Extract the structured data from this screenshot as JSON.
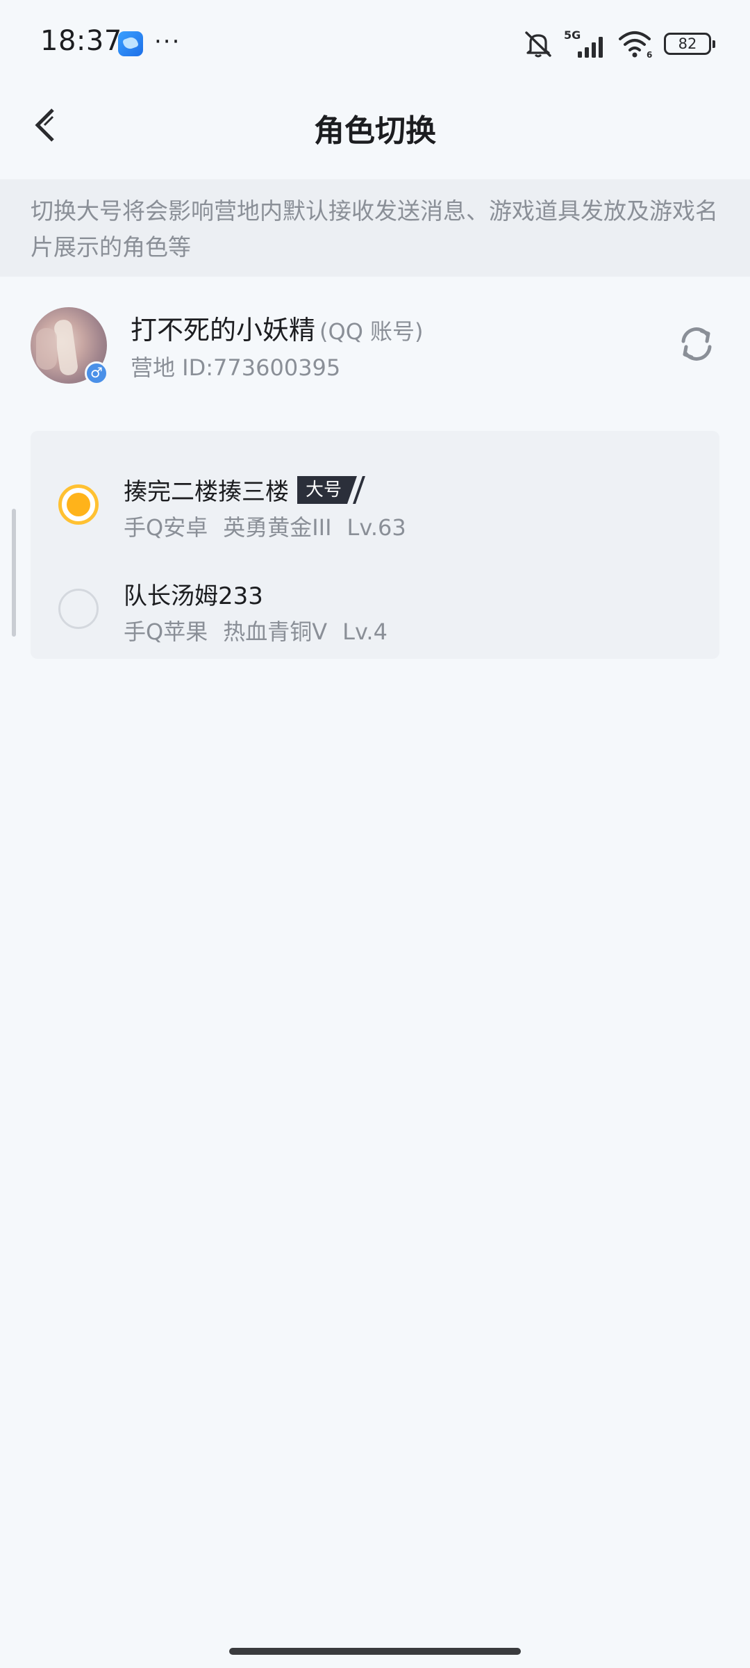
{
  "status_bar": {
    "time": "18:37",
    "more": "···",
    "battery": "82",
    "icons": [
      "app-icon",
      "mute-icon",
      "signal-5g-icon",
      "wifi-icon",
      "battery-icon"
    ]
  },
  "header": {
    "title": "角色切换",
    "back_icon": "chevron-left-icon"
  },
  "notice": {
    "text": "切换大号将会影响营地内默认接收发送消息、游戏道具发放及游戏名片展示的角色等"
  },
  "account": {
    "name": "打不死的小妖精",
    "type": "(QQ 账号)",
    "id": "营地 ID:773600395",
    "gender": "♂",
    "switch_icon": "refresh-icon"
  },
  "roles": [
    {
      "name": "揍完二楼揍三楼",
      "tag": "大号",
      "platform": "手Q安卓",
      "rank": "英勇黄金III",
      "level": "Lv.63",
      "selected": true
    },
    {
      "name": "队长汤姆233",
      "tag": "",
      "platform": "手Q苹果",
      "rank": "热血青铜V",
      "level": "Lv.4",
      "selected": false
    }
  ],
  "colors": {
    "background": "#f5f8fb",
    "accent": "#ffb31a",
    "tag_bg": "#2b2f3a",
    "secondary_text": "#8a8f97"
  }
}
